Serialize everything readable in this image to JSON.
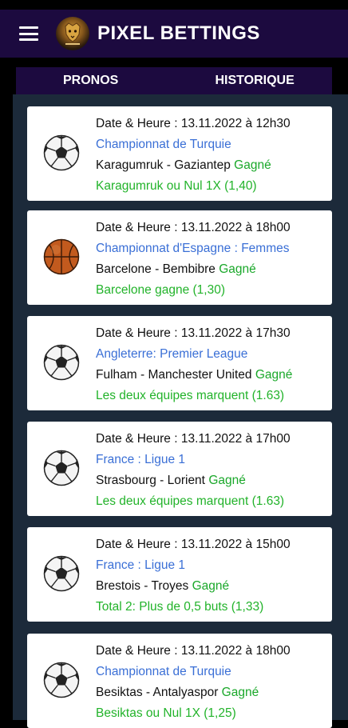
{
  "app": {
    "title": "PIXEL BETTINGS",
    "logo_text": "PIXEL BETTINGS"
  },
  "colors": {
    "header": "#1c0a3f",
    "content_bg": "#1c2a3a",
    "league": "#3a6fd6",
    "win": "#1aa82a"
  },
  "tabs": [
    {
      "label": "PRONOS"
    },
    {
      "label": "HISTORIQUE"
    }
  ],
  "cards": [
    {
      "icon": "soccer-ball-icon",
      "date": "Date & Heure : 13.11.2022 à 12h30",
      "league": "Championnat de Turquie",
      "match": "Karagumruk - Gaziantep",
      "status": "Gagné",
      "tip": "Karagumruk ou Nul 1X (1,40)"
    },
    {
      "icon": "basketball-icon",
      "date": "Date & Heure : 13.11.2022 à 18h00",
      "league": "Championnat d'Espagne : Femmes",
      "match": "Barcelone - Bembibre",
      "status": "Gagné",
      "tip": "Barcelone gagne (1,30)"
    },
    {
      "icon": "soccer-ball-icon",
      "date": "Date & Heure : 13.11.2022 à 17h30",
      "league": "Angleterre: Premier League",
      "match": "Fulham - Manchester United",
      "status": "Gagné",
      "tip": "Les deux équipes marquent (1.63)"
    },
    {
      "icon": "soccer-ball-icon",
      "date": "Date & Heure : 13.11.2022 à 17h00",
      "league": "France : Ligue 1",
      "match": "Strasbourg - Lorient",
      "status": "Gagné",
      "tip": "Les deux équipes marquent (1.63)"
    },
    {
      "icon": "soccer-ball-icon",
      "date": "Date & Heure : 13.11.2022 à 15h00",
      "league": "France : Ligue 1",
      "match": "Brestois - Troyes",
      "status": "Gagné",
      "tip": "Total 2: Plus de 0,5 buts (1,33)"
    },
    {
      "icon": "soccer-ball-icon",
      "date": "Date & Heure : 13.11.2022 à 18h00",
      "league": "Championnat de Turquie",
      "match": "Besiktas - Antalyaspor",
      "status": "Gagné",
      "tip": "Besiktas ou Nul 1X (1,25)"
    }
  ]
}
